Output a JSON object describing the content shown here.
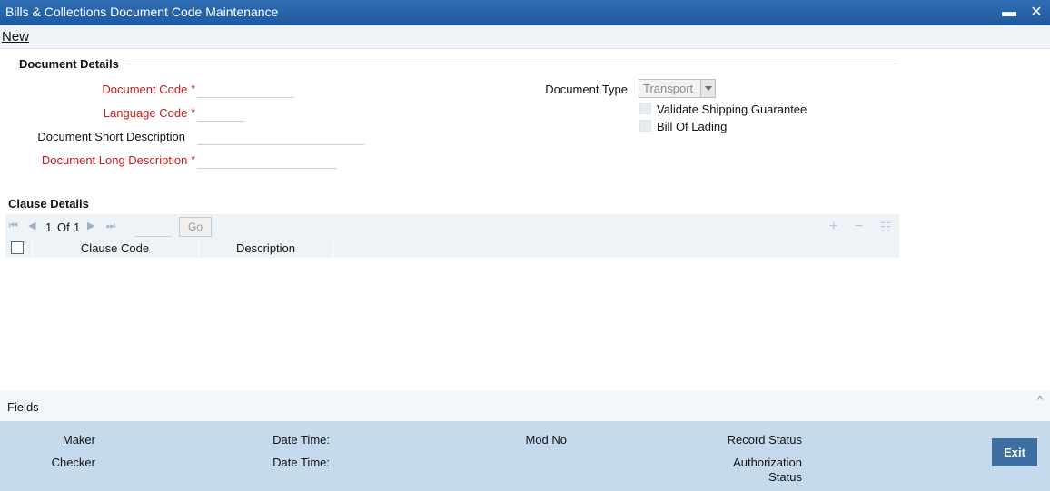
{
  "window": {
    "title": "Bills & Collections Document Code Maintenance",
    "minimize_glyph": "▬",
    "close_glyph": "✕"
  },
  "toolbar": {
    "new_label": "New"
  },
  "document_details": {
    "section_title": "Document Details",
    "document_code_label": "Document Code",
    "language_code_label": "Language Code",
    "short_desc_label": "Document Short Description",
    "long_desc_label": "Document Long Description",
    "required_marker": "*",
    "document_type_label": "Document Type",
    "document_type_value": "Transport",
    "validate_shipping_guarantee_label": "Validate Shipping Guarantee",
    "bill_of_lading_label": "Bill Of Lading"
  },
  "clause_details": {
    "section_title": "Clause Details",
    "page_current": "1",
    "page_of": "Of",
    "page_total": "1",
    "go_label": "Go",
    "columns": [
      "Clause Code",
      "Description"
    ]
  },
  "fields_bar": {
    "label": "Fields"
  },
  "footer": {
    "maker_label": "Maker",
    "checker_label": "Checker",
    "date_time_label": "Date Time:",
    "mod_no_label": "Mod No",
    "record_status_label": "Record Status",
    "authorization_label": "Authorization",
    "status_label": "Status",
    "exit_label": "Exit"
  },
  "colors": {
    "title_bar": "#1f5aa0",
    "required_text": "#c41a1a",
    "footer_bg": "#c5daed",
    "exit_button": "#3d6fa3"
  }
}
